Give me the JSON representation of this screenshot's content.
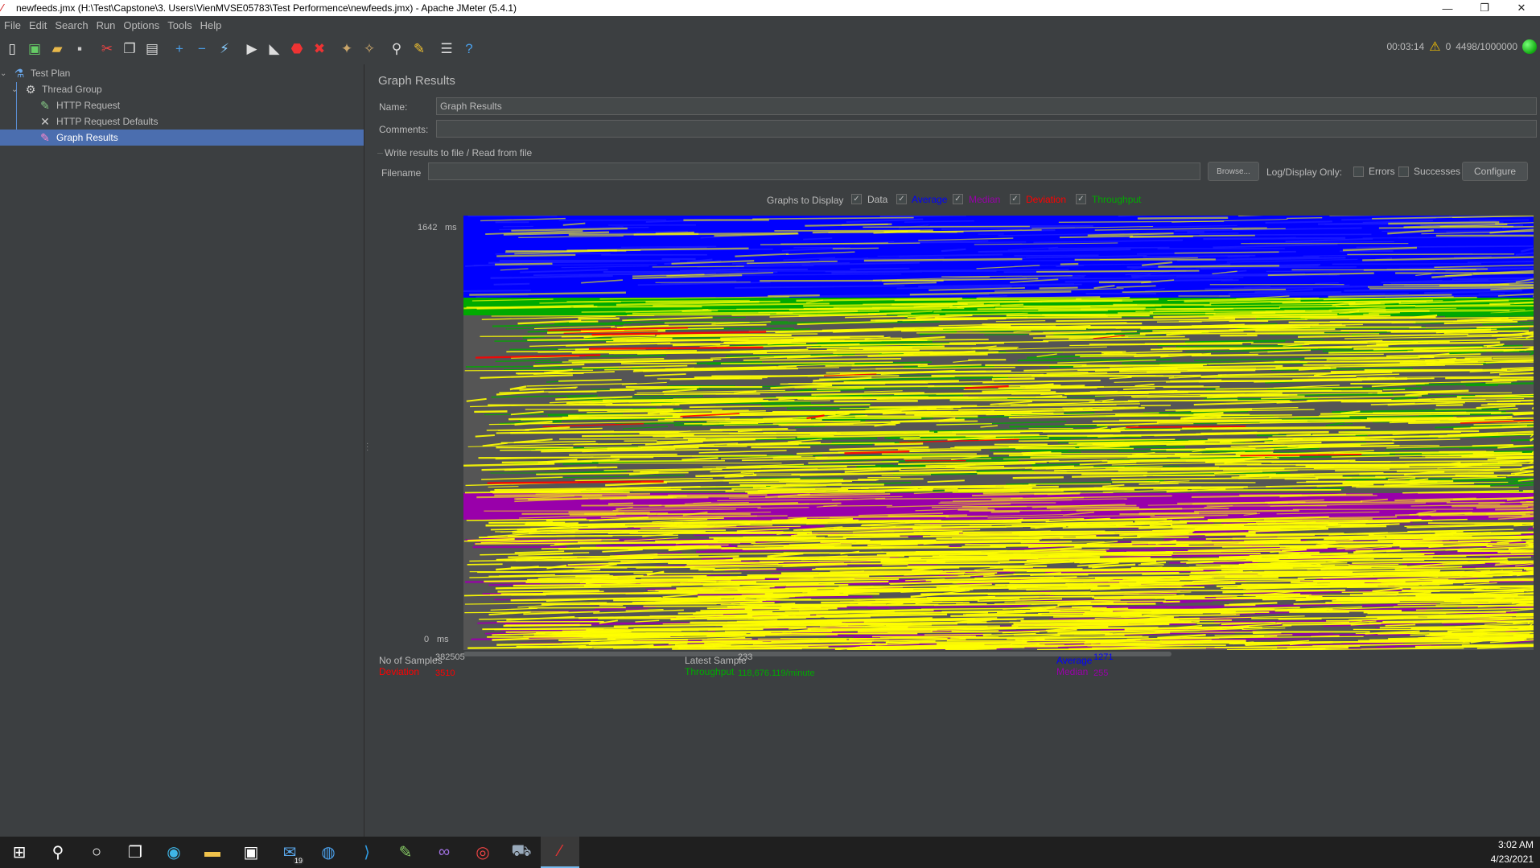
{
  "window": {
    "title": "newfeeds.jmx (H:\\Test\\Capstone\\3. Users\\VienMVSE05783\\Test Performence\\newfeeds.jmx) - Apache JMeter (5.4.1)",
    "minimize": "—",
    "maximize": "❐",
    "close": "✕"
  },
  "menu": [
    "File",
    "Edit",
    "Search",
    "Run",
    "Options",
    "Tools",
    "Help"
  ],
  "toolbar_icons": [
    "new-icon",
    "templates-icon",
    "open-icon",
    "save-icon",
    "cut-icon",
    "copy-icon",
    "paste-icon",
    "expand-icon",
    "collapse-icon",
    "toggle-icon",
    "start-icon",
    "start-no-pause-icon",
    "stop-icon",
    "shutdown-icon",
    "clear-icon",
    "clear-all-icon",
    "search-icon",
    "reset-search-icon",
    "function-helper-icon",
    "help-icon"
  ],
  "status": {
    "elapsed": "00:03:14",
    "warnings": "0",
    "threads": "4498/1000000"
  },
  "tree": {
    "items": [
      {
        "label": "Test Plan",
        "icon": "test-plan-icon"
      },
      {
        "label": "Thread Group",
        "icon": "gear-icon"
      },
      {
        "label": "HTTP Request",
        "icon": "pipette-icon"
      },
      {
        "label": "HTTP Request Defaults",
        "icon": "wrench-icon"
      },
      {
        "label": "Graph Results",
        "icon": "graph-icon"
      }
    ]
  },
  "panel": {
    "title": "Graph Results",
    "name_label": "Name:",
    "name_value": "Graph Results",
    "comments_label": "Comments:",
    "comments_value": "",
    "file_group_title": "Write results to file / Read from file",
    "filename_label": "Filename",
    "filename_value": "",
    "browse_label": "Browse...",
    "log_display_label": "Log/Display Only:",
    "errors_label": "Errors",
    "successes_label": "Successes",
    "configure_label": "Configure"
  },
  "graphs_to_display": {
    "label": "Graphs to Display",
    "options": [
      {
        "label": "Data",
        "color": "#bbbbbb",
        "checked": true
      },
      {
        "label": "Average",
        "color": "#0000ff",
        "checked": true
      },
      {
        "label": "Median",
        "color": "#9900aa",
        "checked": true
      },
      {
        "label": "Deviation",
        "color": "#ff0000",
        "checked": true
      },
      {
        "label": "Throughput",
        "color": "#00aa00",
        "checked": true
      }
    ]
  },
  "graph": {
    "y_max": "1642",
    "y_min": "0",
    "unit": "ms"
  },
  "stats": {
    "samples_label": "No of Samples",
    "samples_value": "382505",
    "deviation_label": "Deviation",
    "deviation_value": "3510",
    "latest_label": "Latest Sample",
    "latest_value": "233",
    "throughput_label": "Throughput",
    "throughput_value": "118,676.119/minute",
    "average_label": "Average",
    "average_value": "1271",
    "median_label": "Median",
    "median_value": "255"
  },
  "taskbar": {
    "apps": [
      "windows-start-icon",
      "search-icon",
      "cortana-icon",
      "task-view-icon",
      "edge-icon",
      "file-explorer-icon",
      "store-icon",
      "mail-icon",
      "app-icon",
      "vscode-icon",
      "notepad-plus-icon",
      "visual-studio-icon",
      "chrome-icon",
      "docker-icon",
      "jmeter-icon"
    ],
    "mail_badge": "19",
    "time": "3:02 AM",
    "date": "4/23/2021"
  }
}
